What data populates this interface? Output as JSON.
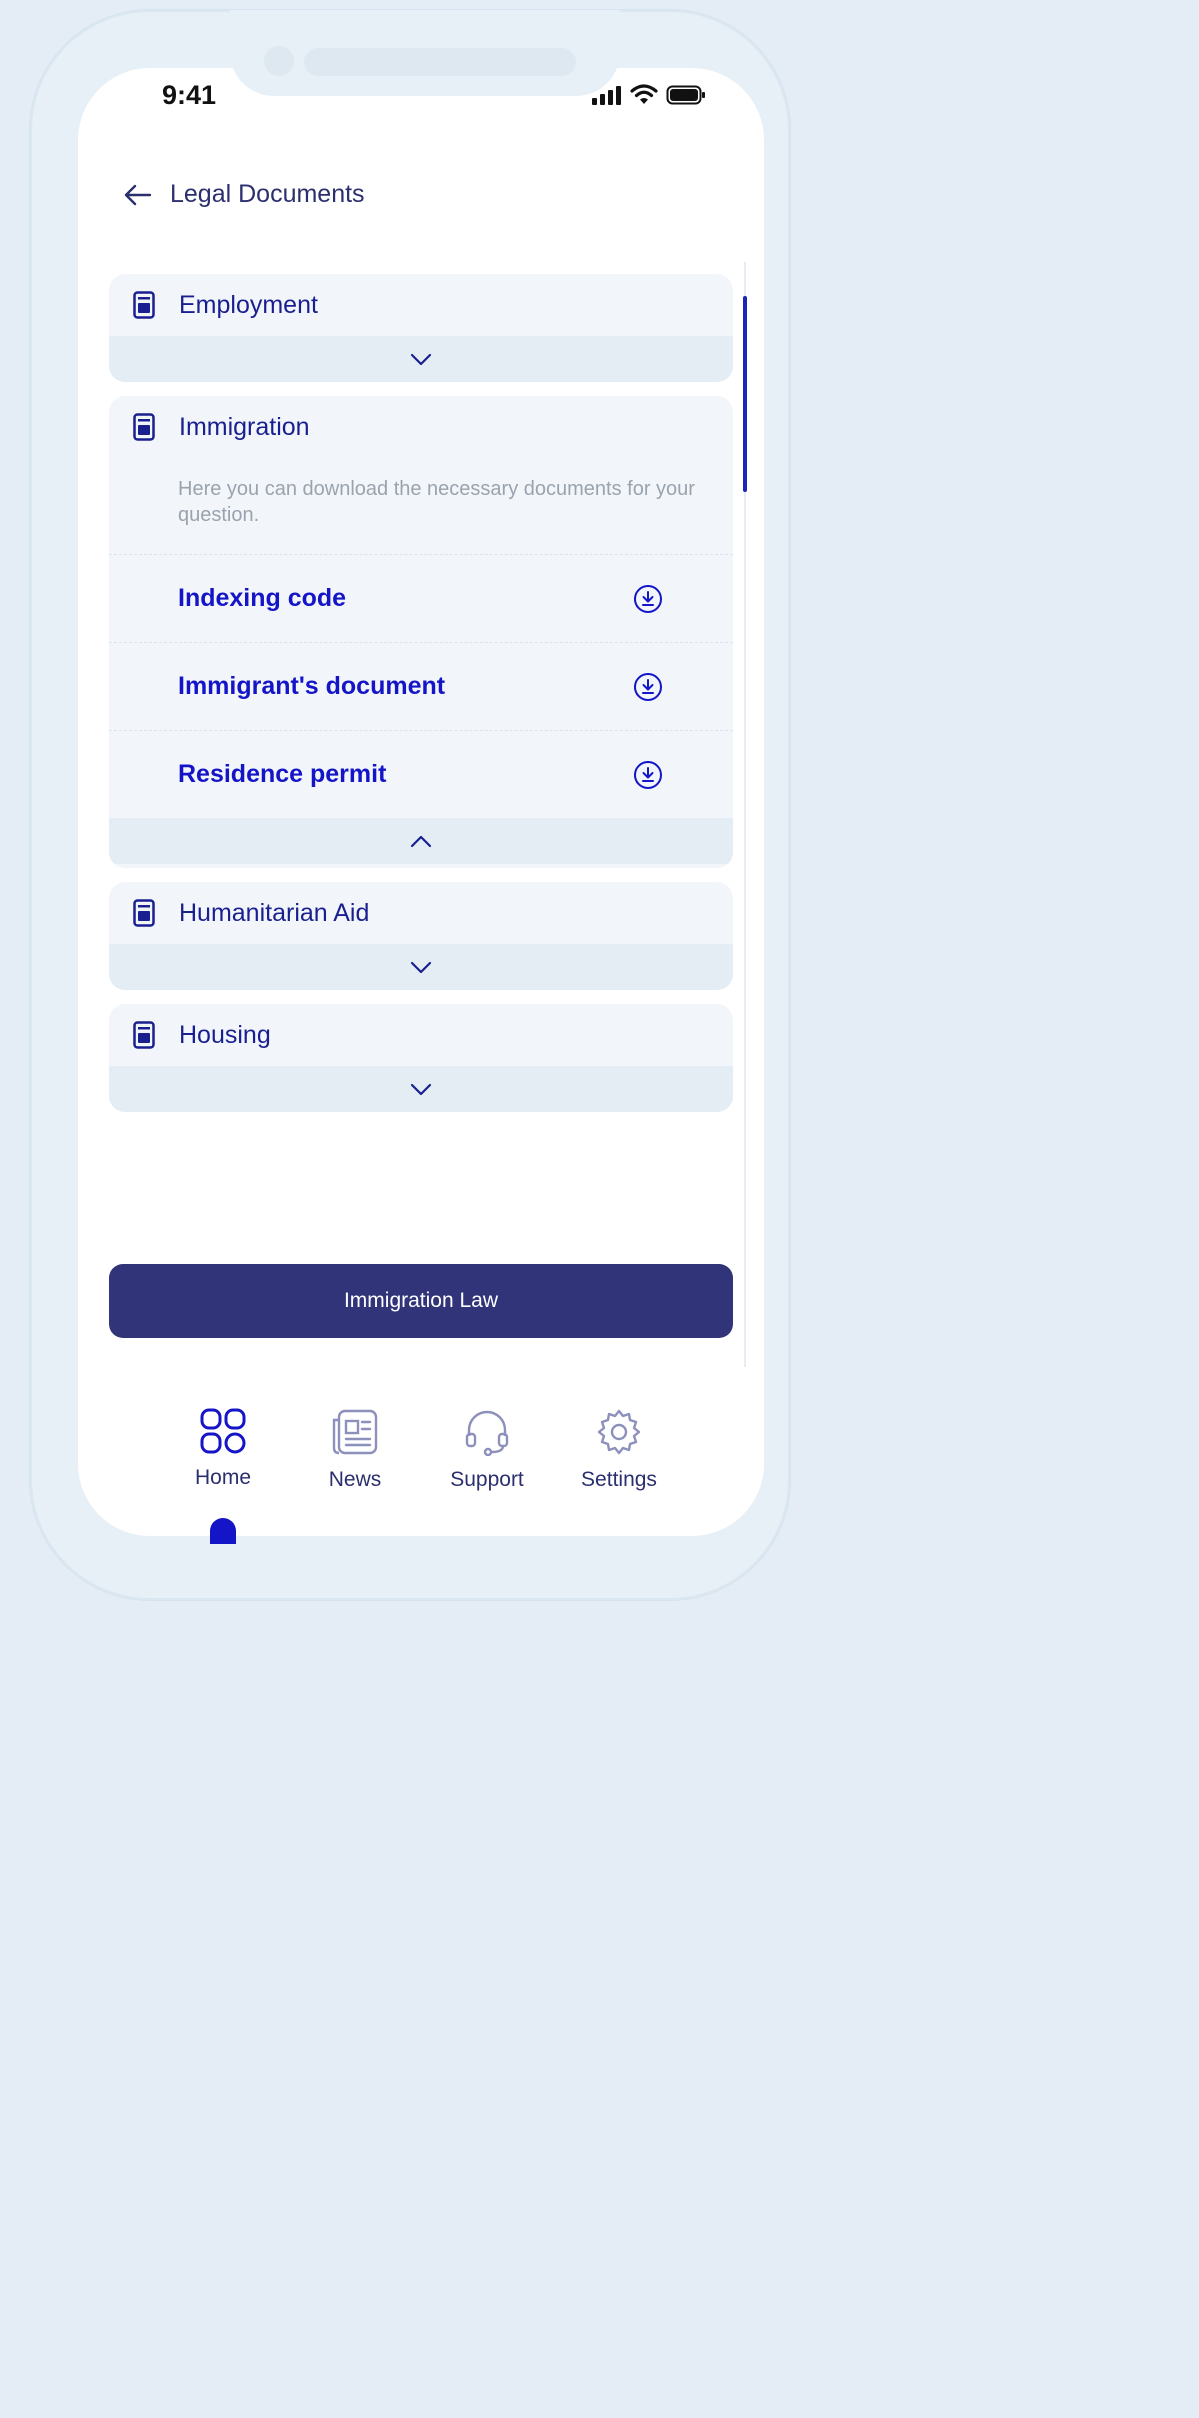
{
  "status_bar": {
    "time": "9:41"
  },
  "header": {
    "title": "Legal Documents"
  },
  "categories": [
    {
      "label": "Employment",
      "icon": "document-icon",
      "expanded": false
    },
    {
      "label": "Immigration",
      "icon": "document-icon",
      "expanded": true,
      "description": "Here you can download the necessary documents for your question.",
      "documents": [
        {
          "name": "Indexing code",
          "icon": "download-icon"
        },
        {
          "name": "Immigrant's document",
          "icon": "download-icon"
        },
        {
          "name": "Residence permit",
          "icon": "download-icon"
        }
      ]
    },
    {
      "label": "Humanitarian Aid",
      "icon": "document-icon",
      "expanded": false
    },
    {
      "label": "Housing",
      "icon": "document-icon",
      "expanded": false
    }
  ],
  "cta": {
    "label": "Immigration Law"
  },
  "bottom_nav": [
    {
      "label": "Home",
      "icon": "grid-icon",
      "active": true
    },
    {
      "label": "News",
      "icon": "newspaper-icon",
      "active": false
    },
    {
      "label": "Support",
      "icon": "headset-icon",
      "active": false
    },
    {
      "label": "Settings",
      "icon": "gear-icon",
      "active": false
    }
  ],
  "colors": {
    "accent": "#1515c8",
    "primary_dark": "#313479",
    "card_bg": "#f2f6fb",
    "card_footer": "#e3edf3"
  }
}
